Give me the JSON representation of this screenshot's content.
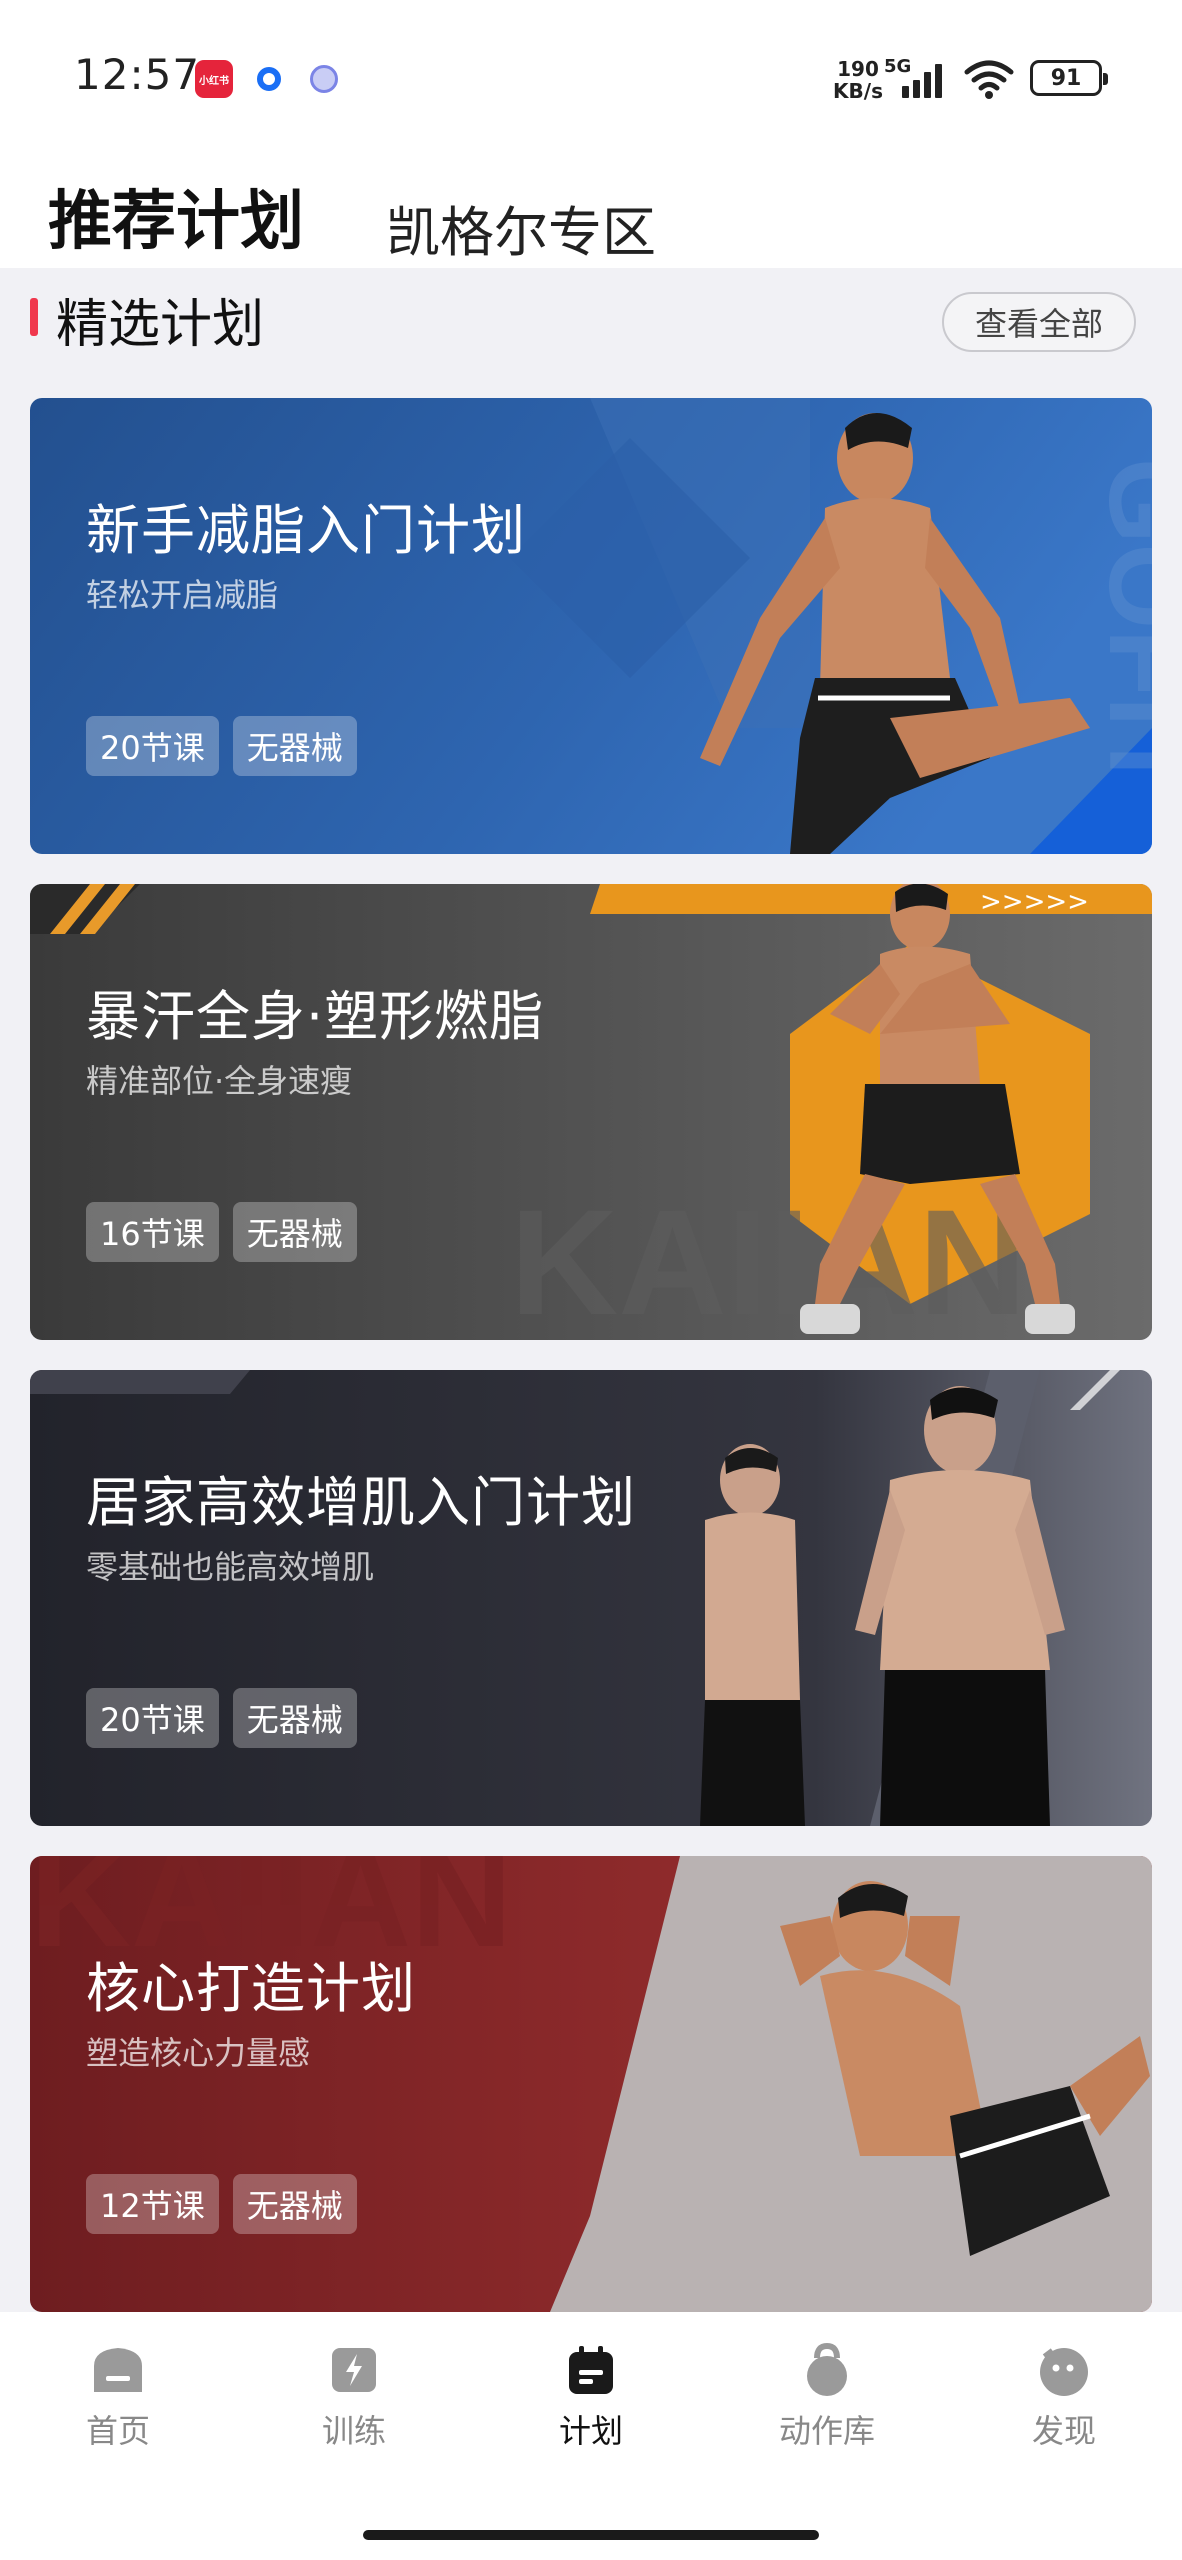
{
  "status_bar": {
    "time": "12:57",
    "app_icon_xhs": "小红书",
    "net_speed_value": "190",
    "net_speed_unit": "KB/s",
    "network": "5G",
    "battery": "91"
  },
  "header": {
    "tab_active": "推荐计划",
    "tab_inactive": "凯格尔专区"
  },
  "section": {
    "title": "精选计划",
    "view_all": "查看全部"
  },
  "cards": [
    {
      "title": "新手减脂入门计划",
      "subtitle": "轻松开启减脂",
      "tags": [
        "20节课",
        "无器械"
      ],
      "bg_color": "#2b5a9e",
      "watermark": "GOFIT"
    },
    {
      "title": "暴汗全身·塑形燃脂",
      "subtitle": "精准部位·全身速瘦",
      "tags": [
        "16节课",
        "无器械"
      ],
      "bg_color": "#4a4a4a",
      "watermark": "KAIIAN"
    },
    {
      "title": "居家高效增肌入门计划",
      "subtitle": "零基础也能高效增肌",
      "tags": [
        "20节课",
        "无器械"
      ],
      "bg_color": "#2a2b33"
    },
    {
      "title": "核心打造计划",
      "subtitle": "塑造核心力量感",
      "tags": [
        "12节课",
        "无器械"
      ],
      "bg_color": "#7e2426",
      "watermark": "KAIIAN"
    }
  ],
  "bottom_nav": [
    {
      "label": "首页",
      "icon": "home-icon",
      "active": false
    },
    {
      "label": "训练",
      "icon": "training-icon",
      "active": false
    },
    {
      "label": "计划",
      "icon": "plan-icon",
      "active": true
    },
    {
      "label": "动作库",
      "icon": "kettlebell-icon",
      "active": false
    },
    {
      "label": "发现",
      "icon": "discover-icon",
      "active": false
    }
  ],
  "colors": {
    "accent_red": "#f0384d",
    "content_bg": "#f1f1f5"
  }
}
